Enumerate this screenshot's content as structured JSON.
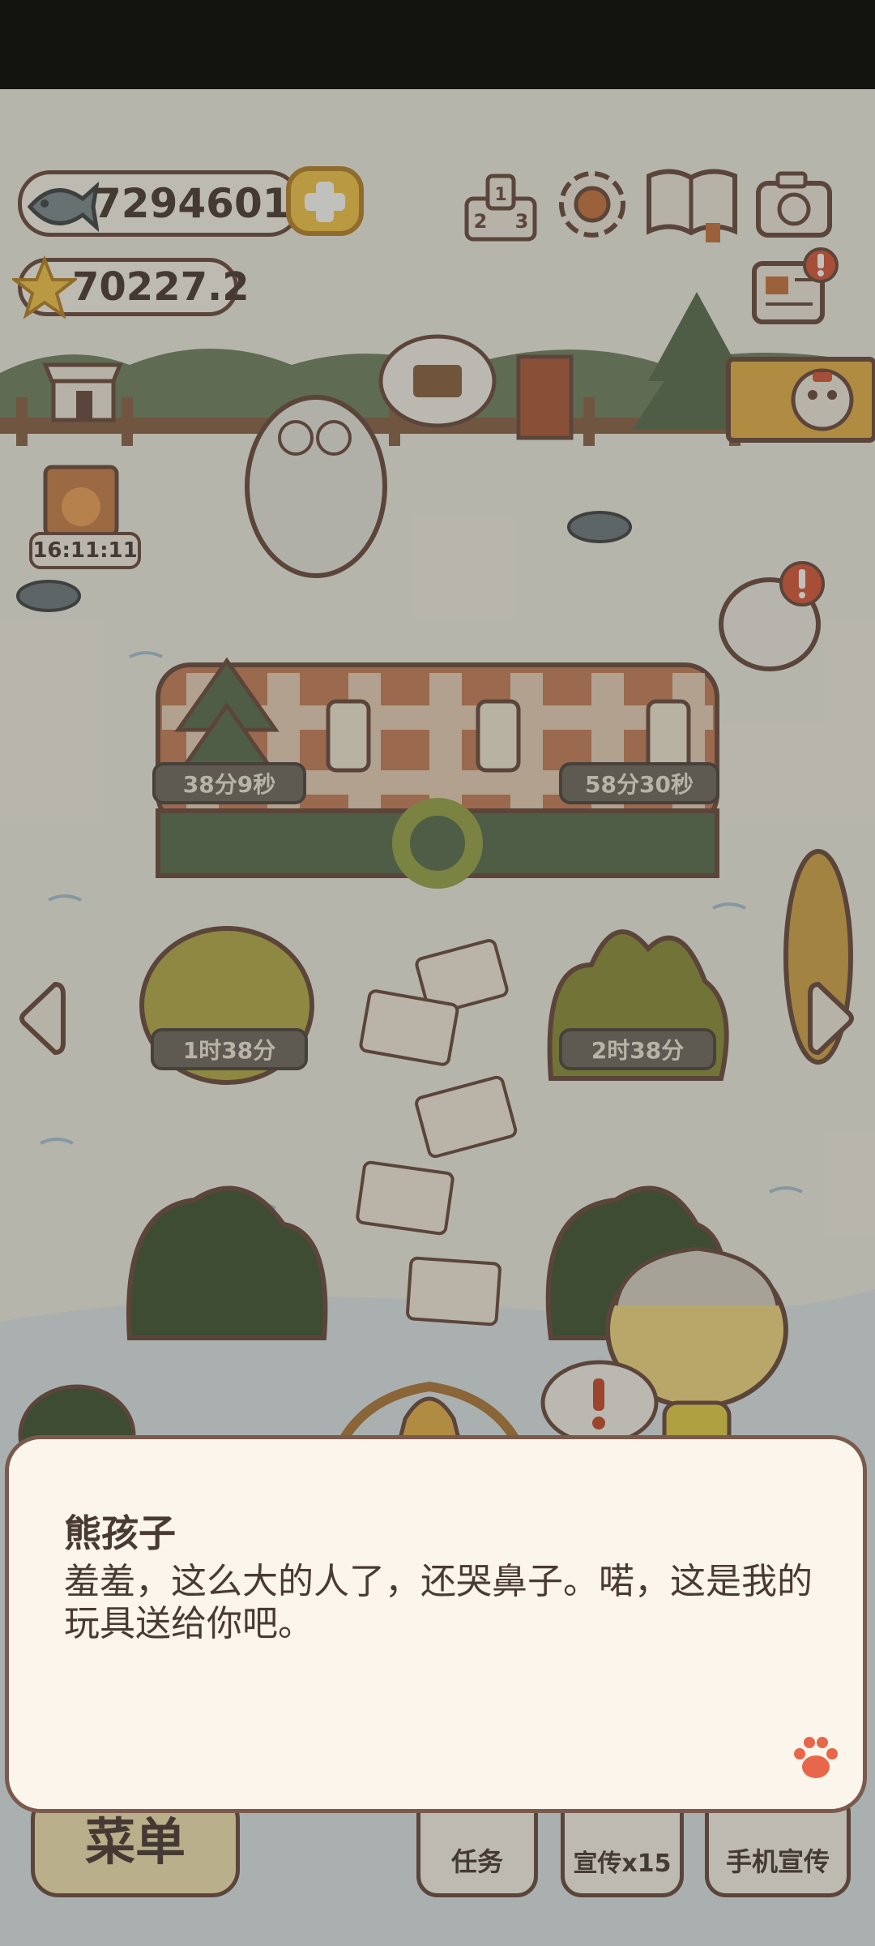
{
  "status_bar": {},
  "hud": {
    "fish_count": "7294601",
    "star_count": "70227.2",
    "rank_icon_digits": [
      "2",
      "1",
      "3"
    ],
    "sign_timer": "16:11:11"
  },
  "timers": {
    "table_left": "38分9秒",
    "table_right": "58分30秒",
    "bush_left": "1时38分",
    "bush_right": "2时38分"
  },
  "dialog": {
    "speaker": "熊孩子",
    "text": "羞羞，这么大的人了，还哭鼻子。喏，这是我的玩具送给你吧。"
  },
  "bottom_menu": {
    "menu": "菜单",
    "tasks": "任务",
    "promote": "宣传x15",
    "phone_promote": "手机宣传"
  },
  "colors": {
    "outline": "#6b4a3e",
    "cream": "#fbf6ee",
    "accent_yellow": "#f5c84a",
    "alert_red": "#d9583b"
  }
}
